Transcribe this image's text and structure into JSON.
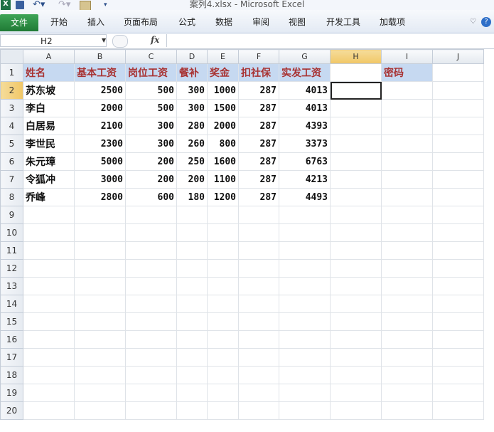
{
  "window": {
    "title": "案列4.xlsx  -  Microsoft Excel",
    "app_icon": "X"
  },
  "ribbon": {
    "tabs": [
      "文件",
      "开始",
      "插入",
      "页面布局",
      "公式",
      "数据",
      "审阅",
      "视图",
      "开发工具",
      "加载项"
    ],
    "help_label": "?"
  },
  "formula_bar": {
    "name_box": "H2",
    "fx_label": "fx",
    "formula": ""
  },
  "sheet": {
    "columns": [
      "A",
      "B",
      "C",
      "D",
      "E",
      "F",
      "G",
      "H",
      "I",
      "J"
    ],
    "rows": [
      "1",
      "2",
      "3",
      "4",
      "5",
      "6",
      "7",
      "8",
      "9",
      "10",
      "11",
      "12",
      "13",
      "14",
      "15",
      "16",
      "17",
      "18",
      "19",
      "20"
    ],
    "selected_cell": "H2",
    "header": [
      "姓名",
      "基本工资",
      "岗位工资",
      "餐补",
      "奖金",
      "扣社保",
      "实发工资"
    ],
    "extra_header": "密码",
    "data": [
      [
        "苏东坡",
        "2500",
        "500",
        "300",
        "1000",
        "287",
        "4013"
      ],
      [
        "李白",
        "2000",
        "500",
        "300",
        "1500",
        "287",
        "4013"
      ],
      [
        "白居易",
        "2100",
        "300",
        "280",
        "2000",
        "287",
        "4393"
      ],
      [
        "李世民",
        "2300",
        "300",
        "260",
        "800",
        "287",
        "3373"
      ],
      [
        "朱元璋",
        "5000",
        "200",
        "250",
        "1600",
        "287",
        "6763"
      ],
      [
        "令狐冲",
        "3000",
        "200",
        "200",
        "1100",
        "287",
        "4213"
      ],
      [
        "乔峰",
        "2800",
        "600",
        "180",
        "1200",
        "287",
        "4493"
      ]
    ]
  },
  "colors": {
    "header_fill": "#c6d9f1",
    "header_text": "#a83232",
    "file_tab": "#2f8f46"
  }
}
